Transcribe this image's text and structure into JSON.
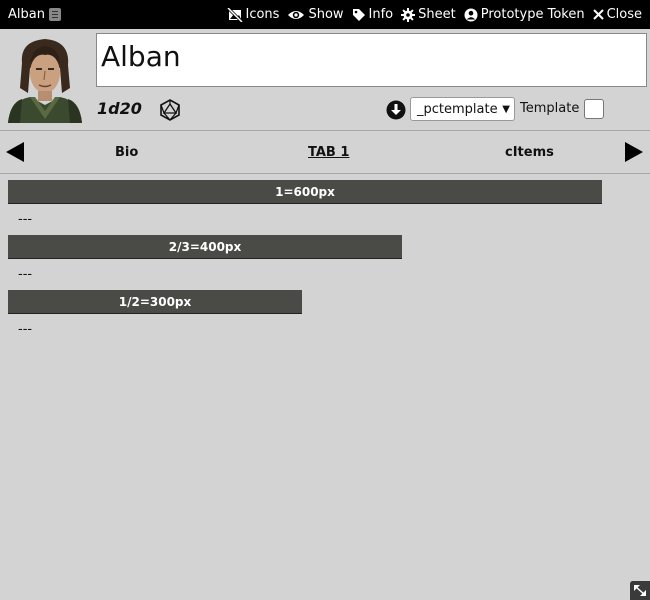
{
  "window": {
    "title": "Alban",
    "controls": [
      {
        "label": "Icons",
        "icon": "no-image-icon"
      },
      {
        "label": "Show",
        "icon": "eye-icon"
      },
      {
        "label": "Info",
        "icon": "tag-icon"
      },
      {
        "label": "Sheet",
        "icon": "gear-icon"
      },
      {
        "label": "Prototype Token",
        "icon": "user-circle-icon"
      },
      {
        "label": "Close",
        "icon": "close-icon"
      }
    ]
  },
  "profile": {
    "name": "Alban",
    "dice_formula": "1d20"
  },
  "template": {
    "selected": "_pctemplate",
    "label": "Template",
    "checked": false
  },
  "tabs": [
    {
      "label": "Bio",
      "active": false
    },
    {
      "label": "TAB 1",
      "active": true
    },
    {
      "label": "cItems",
      "active": false
    }
  ],
  "content": {
    "rows": [
      {
        "bar_label": "1=600px",
        "fraction": 1.0,
        "text": "---"
      },
      {
        "bar_label": "2/3=400px",
        "fraction": 0.6667,
        "text": "---"
      },
      {
        "bar_label": "1/2=300px",
        "fraction": 0.5,
        "text": "---"
      }
    ]
  },
  "colors": {
    "background": "#d3d3d3",
    "header": "#000000",
    "bar": "#4a4a46"
  }
}
